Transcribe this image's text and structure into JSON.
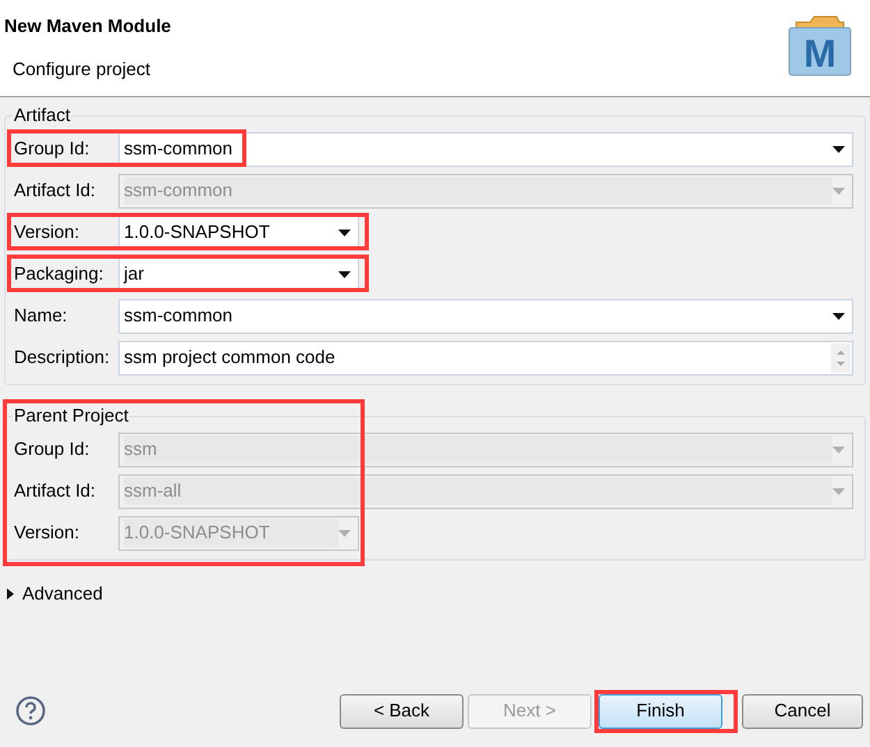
{
  "window": {
    "title": "New Maven Module",
    "subtitle": "Configure project",
    "logo": "M"
  },
  "artifact": {
    "title": "Artifact",
    "fields": [
      {
        "label": "Group Id:",
        "value": "ssm-common",
        "kind": "combo",
        "disabled": false,
        "highlighted": true
      },
      {
        "label": "Artifact Id:",
        "value": "ssm-common",
        "kind": "combo",
        "disabled": true,
        "highlighted": false
      },
      {
        "label": "Version:",
        "value": "1.0.0-SNAPSHOT",
        "kind": "short-combo",
        "disabled": false,
        "highlighted": true
      },
      {
        "label": "Packaging:",
        "value": "jar",
        "kind": "short-combo",
        "disabled": false,
        "highlighted": true
      },
      {
        "label": "Name:",
        "value": "ssm-common",
        "kind": "combo",
        "disabled": false,
        "highlighted": false
      },
      {
        "label": "Description:",
        "value": "ssm project common code",
        "kind": "text",
        "disabled": false,
        "highlighted": false
      }
    ]
  },
  "parent": {
    "title": "Parent Project",
    "highlighted": true,
    "fields": [
      {
        "label": "Group Id:",
        "value": "ssm",
        "kind": "combo",
        "disabled": true,
        "highlighted": false
      },
      {
        "label": "Artifact Id:",
        "value": "ssm-all",
        "kind": "combo",
        "disabled": true,
        "highlighted": false
      },
      {
        "label": "Version:",
        "value": "1.0.0-SNAPSHOT",
        "kind": "short-combo",
        "disabled": true,
        "highlighted": false
      }
    ]
  },
  "advanced": {
    "label": "Advanced",
    "expanded": false
  },
  "buttons": [
    {
      "label": "< Back",
      "disabled": false,
      "default": false,
      "highlighted": false
    },
    {
      "label": "Next >",
      "disabled": true,
      "default": false,
      "highlighted": false
    },
    {
      "label": "Finish",
      "disabled": false,
      "default": true,
      "highlighted": true
    },
    {
      "label": "Cancel",
      "disabled": false,
      "default": false,
      "highlighted": false
    }
  ]
}
